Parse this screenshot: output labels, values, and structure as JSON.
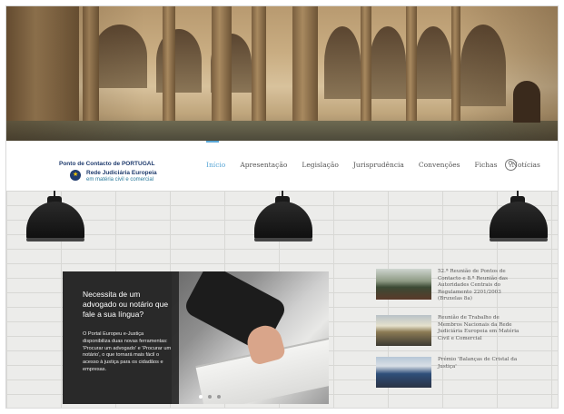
{
  "navbar": {
    "brand": {
      "line1": "Ponto de Contacto de PORTUGAL",
      "name": "Rede Judiciária Europeia",
      "subtitle": "em matéria civil e comercial"
    },
    "items": [
      {
        "label": "Início",
        "active": true
      },
      {
        "label": "Apresentação"
      },
      {
        "label": "Legislação"
      },
      {
        "label": "Jurisprudência"
      },
      {
        "label": "Convenções"
      },
      {
        "label": "Fichas"
      },
      {
        "label": "Notícias"
      }
    ],
    "search_icon": "search-icon",
    "accent_color": "#5aa7d6"
  },
  "slider": {
    "title": "Necessita de um advogado ou notário que fale a sua língua?",
    "text": "O Portal Europeu e-Justiça disponibiliza duas novas ferramentas: 'Procurar um advogado' e 'Procurar um notário', o que tornará mais fácil o acesso à justiça para os cidadãos e empresas.",
    "slide_count": 3,
    "active_slide": 1
  },
  "news": [
    {
      "title": "52.ª Reunião de Pontos de Contacto e 8.ª Reunião das Autoridades Centrais do Regulamento 2201/2003 (Bruxelas 8a)"
    },
    {
      "title": "Reunião de Trabalho de Membros Nacionais da Rede Judiciária Europeia em Matéria Civil e Comercial"
    },
    {
      "title": "Prémio 'Balanças de Cristal da Justiça'"
    }
  ]
}
